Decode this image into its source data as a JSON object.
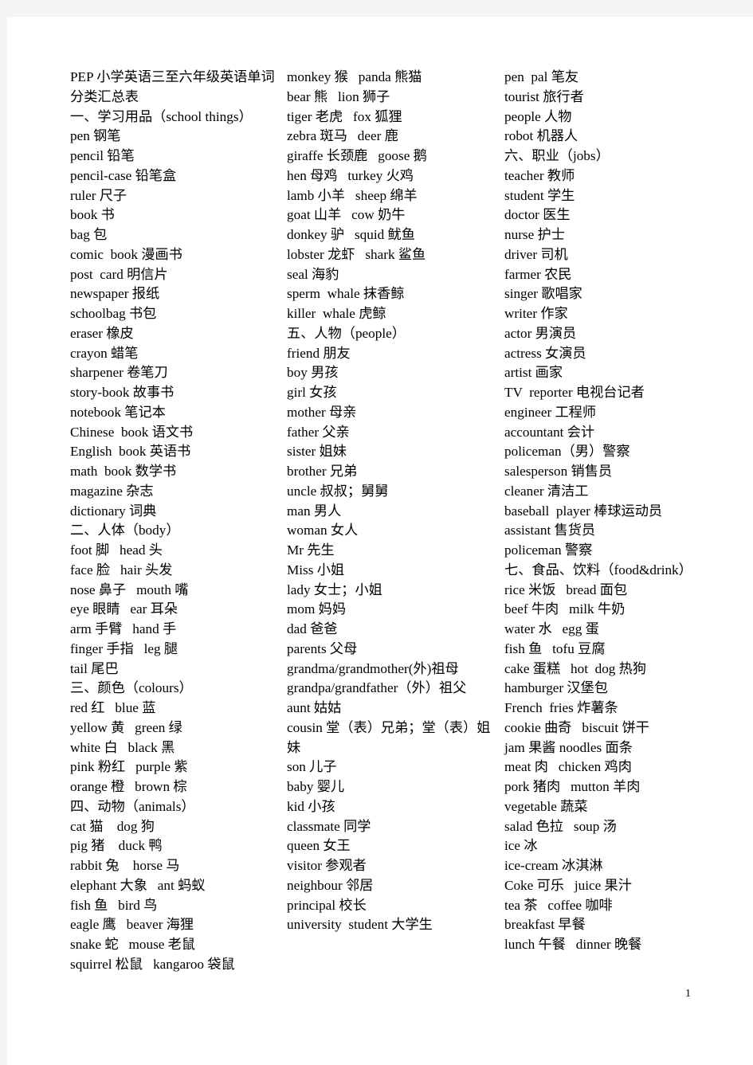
{
  "document": {
    "title": "PEP 小学英语三至六年级英语单词分类汇总表",
    "page_number": "1"
  },
  "columns": {
    "col1": [
      "PEP 小学英语三至六年级英语单词分类汇总表",
      "一、学习用品（school things）",
      "pen 钢笔",
      "pencil 铅笔",
      "pencil-case 铅笔盒",
      "ruler 尺子",
      "book 书",
      "bag 包",
      "comic  book 漫画书",
      "post  card 明信片",
      "newspaper 报纸",
      "schoolbag 书包",
      "eraser 橡皮",
      "crayon 蜡笔",
      "sharpener 卷笔刀",
      "story-book 故事书",
      "notebook 笔记本",
      "Chinese  book 语文书",
      "English  book 英语书",
      "math  book 数学书",
      "magazine 杂志",
      "dictionary 词典",
      "二、人体（body）",
      "foot 脚   head 头",
      "face 脸   hair 头发",
      "nose 鼻子   mouth 嘴",
      "eye 眼睛   ear 耳朵",
      "arm 手臂   hand 手",
      "finger 手指   leg 腿",
      "tail 尾巴",
      "三、颜色（colours）",
      "red 红   blue 蓝",
      "yellow 黄   green 绿",
      "white 白   black 黑",
      "pink 粉红   purple 紫",
      "orange 橙   brown 棕",
      "四、动物（animals）",
      "cat 猫    dog 狗",
      "pig 猪    duck 鸭",
      "rabbit 兔    horse 马",
      "elephant 大象   ant 蚂蚁",
      "fish 鱼   bird 鸟",
      "eagle 鹰   beaver 海狸",
      "snake 蛇   mouse 老鼠",
      "squirrel 松鼠   kangaroo 袋鼠"
    ],
    "col2": [
      "monkey 猴   panda 熊猫",
      "bear 熊   lion 狮子",
      "tiger 老虎   fox 狐狸",
      "zebra 斑马   deer 鹿",
      "giraffe 长颈鹿   goose 鹅",
      "hen 母鸡   turkey 火鸡",
      "lamb 小羊   sheep 绵羊",
      "goat 山羊   cow 奶牛",
      "donkey 驴   squid 鱿鱼",
      "lobster 龙虾   shark 鲨鱼",
      "seal 海豹",
      "sperm  whale 抹香鲸",
      "killer  whale 虎鲸",
      "五、人物（people）",
      "friend 朋友",
      "boy 男孩",
      "girl 女孩",
      "mother 母亲",
      "father 父亲",
      "sister 姐妹",
      "brother 兄弟",
      "uncle 叔叔；舅舅",
      "man 男人",
      "woman 女人",
      "Mr 先生",
      "Miss 小姐",
      "lady 女士；小姐",
      "mom 妈妈",
      "dad 爸爸",
      "parents 父母",
      "grandma/grandmother(外)祖母",
      "grandpa/grandfather（外）祖父",
      "aunt 姑姑",
      "cousin 堂（表）兄弟；堂（表）姐妹",
      "son 儿子",
      "baby 婴儿",
      "kid 小孩",
      "classmate 同学",
      "queen 女王",
      "visitor 参观者",
      "neighbour 邻居",
      "principal 校长",
      "university  student 大学生"
    ],
    "col3": [
      "pen  pal 笔友",
      "tourist 旅行者",
      "people 人物",
      "robot 机器人",
      "六、职业（jobs）",
      "teacher 教师",
      "student 学生",
      "doctor 医生",
      "nurse 护士",
      "driver 司机",
      "farmer 农民",
      "singer 歌唱家",
      "writer 作家",
      "actor 男演员",
      "actress 女演员",
      "artist 画家",
      "TV  reporter 电视台记者",
      "engineer 工程师",
      "accountant 会计",
      "policeman（男）警察",
      "salesperson 销售员",
      "cleaner 清洁工",
      "baseball  player 棒球运动员",
      "assistant 售货员",
      "policeman 警察",
      "七、食品、饮料（food&drink）",
      "rice 米饭   bread 面包",
      "beef 牛肉   milk 牛奶",
      "water 水   egg 蛋",
      "fish 鱼   tofu 豆腐",
      "cake 蛋糕   hot  dog 热狗",
      "hamburger 汉堡包",
      "French  fries 炸薯条",
      "cookie 曲奇   biscuit 饼干",
      "jam 果酱 noodles 面条",
      "meat 肉   chicken 鸡肉",
      "pork 猪肉   mutton 羊肉",
      "vegetable 蔬菜",
      "salad 色拉   soup 汤",
      "ice 冰",
      "ice-cream 冰淇淋",
      "Coke 可乐   juice 果汁",
      "tea 茶   coffee 咖啡",
      "breakfast 早餐",
      "lunch 午餐   dinner 晚餐"
    ]
  }
}
